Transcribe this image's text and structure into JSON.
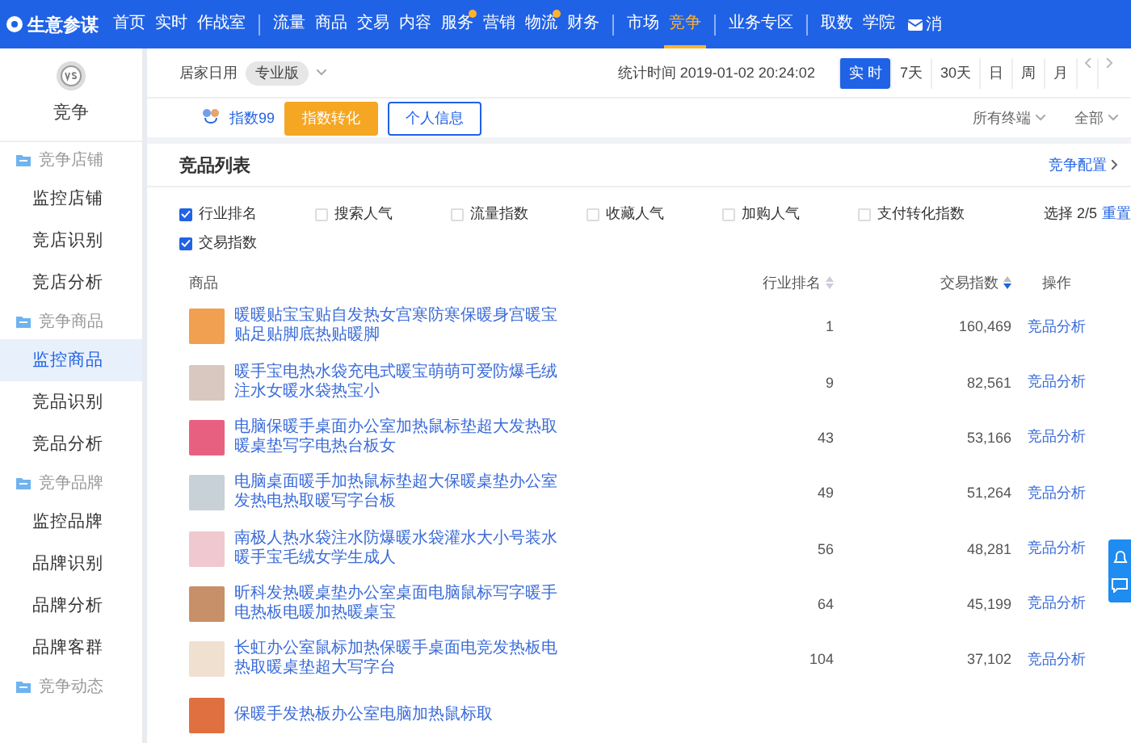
{
  "nav": {
    "logo": "生意参谋",
    "groups": [
      [
        {
          "label": "首页",
          "selected": false,
          "dot": false
        },
        {
          "label": "实时",
          "selected": false,
          "dot": false
        },
        {
          "label": "作战室",
          "selected": false,
          "dot": false
        }
      ],
      [
        {
          "label": "流量",
          "selected": false,
          "dot": false
        },
        {
          "label": "商品",
          "selected": false,
          "dot": false
        },
        {
          "label": "交易",
          "selected": false,
          "dot": false
        },
        {
          "label": "内容",
          "selected": false,
          "dot": false
        },
        {
          "label": "服务",
          "selected": false,
          "dot": true
        },
        {
          "label": "营销",
          "selected": false,
          "dot": false
        },
        {
          "label": "物流",
          "selected": false,
          "dot": true
        },
        {
          "label": "财务",
          "selected": false,
          "dot": false
        }
      ],
      [
        {
          "label": "市场",
          "selected": false,
          "dot": false
        },
        {
          "label": "竞争",
          "selected": true,
          "dot": false
        }
      ],
      [
        {
          "label": "业务专区",
          "selected": false,
          "dot": false
        }
      ],
      [
        {
          "label": "取数",
          "selected": false,
          "dot": false
        },
        {
          "label": "学院",
          "selected": false,
          "dot": false
        }
      ]
    ],
    "trailing": "消"
  },
  "sidebar": {
    "title": "竞争",
    "groups": [
      {
        "label": "竞争店铺",
        "items": [
          {
            "label": "监控店铺",
            "selected": false
          },
          {
            "label": "竞店识别",
            "selected": false
          },
          {
            "label": "竞店分析",
            "selected": false
          }
        ]
      },
      {
        "label": "竞争商品",
        "items": [
          {
            "label": "监控商品",
            "selected": true
          },
          {
            "label": "竞品识别",
            "selected": false
          },
          {
            "label": "竞品分析",
            "selected": false
          }
        ]
      },
      {
        "label": "竞争品牌",
        "items": [
          {
            "label": "监控品牌",
            "selected": false
          },
          {
            "label": "品牌识别",
            "selected": false
          },
          {
            "label": "品牌分析",
            "selected": false
          },
          {
            "label": "品牌客群",
            "selected": false
          }
        ]
      },
      {
        "label": "竞争动态"
      }
    ]
  },
  "toolbar": {
    "category": "居家日用",
    "edition": "专业版",
    "stat_time": "统计时间 2019-01-02 20:24:02",
    "periods": [
      {
        "label": "实 时",
        "selected": true
      },
      {
        "label": "7天",
        "selected": false
      },
      {
        "label": "30天",
        "selected": false
      },
      {
        "label": "日",
        "selected": false
      },
      {
        "label": "周",
        "selected": false
      },
      {
        "label": "月",
        "selected": false
      }
    ]
  },
  "subbar": {
    "index_link": "指数99",
    "primary_button": "指数转化",
    "secondary_button": "个人信息",
    "terminal": "所有终端",
    "scope": "全部"
  },
  "card": {
    "title": "竞品列表",
    "config_link": "竞争配置",
    "filters": [
      {
        "label": "行业排名",
        "checked": true
      },
      {
        "label": "搜索人气",
        "checked": false
      },
      {
        "label": "流量指数",
        "checked": false
      },
      {
        "label": "收藏人气",
        "checked": false
      },
      {
        "label": "加购人气",
        "checked": false
      },
      {
        "label": "支付转化指数",
        "checked": false
      },
      {
        "label": "交易指数",
        "checked": true
      }
    ],
    "selection_count": "选择 2/5",
    "reset": "重置",
    "columns": [
      "商品",
      "行业排名",
      "交易指数",
      "操作"
    ],
    "rows": [
      {
        "name": "暖暖贴宝宝贴自发热女宫寒防寒保暖身宫暖宝贴足贴脚底热贴暖脚",
        "rank": "1",
        "index": "160,469",
        "action": "竞品分析"
      },
      {
        "name": "暖手宝电热水袋充电式暖宝萌萌可爱防爆毛绒注水女暖水袋热宝小",
        "rank": "9",
        "index": "82,561",
        "action": "竞品分析"
      },
      {
        "name": "电脑保暖手桌面办公室加热鼠标垫超大发热取暖桌垫写字电热台板女",
        "rank": "43",
        "index": "53,166",
        "action": "竞品分析"
      },
      {
        "name": "电脑桌面暖手加热鼠标垫超大保暖桌垫办公室发热电热取暖写字台板",
        "rank": "49",
        "index": "51,264",
        "action": "竞品分析"
      },
      {
        "name": "南极人热水袋注水防爆暖水袋灌水大小号装水暖手宝毛绒女学生成人",
        "rank": "56",
        "index": "48,281",
        "action": "竞品分析"
      },
      {
        "name": "昕科发热暖桌垫办公室桌面电脑鼠标写字暖手电热板电暖加热暖桌宝",
        "rank": "64",
        "index": "45,199",
        "action": "竞品分析"
      },
      {
        "name": "长虹办公室鼠标加热保暖手桌面电竞发热板电热取暖桌垫超大写字台",
        "rank": "104",
        "index": "37,102",
        "action": "竞品分析"
      },
      {
        "name": "保暖手发热板办公室电脑加热鼠标取"
      }
    ]
  }
}
